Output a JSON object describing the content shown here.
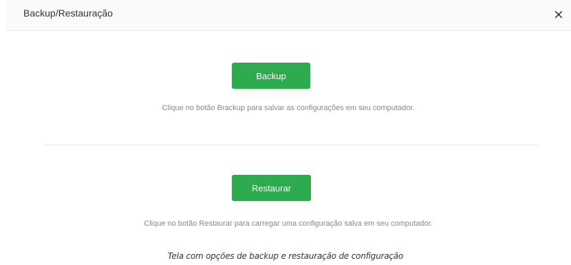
{
  "dialog": {
    "title": "Backup/Restauração",
    "close_symbol": "×"
  },
  "backup": {
    "button_label": "Backup",
    "description": "Clique no botão Brackup para salvar as configurações em seu computador."
  },
  "restore": {
    "button_label": "Restaurar",
    "description": "Clique no botão Restaurar para carregar uma configuração salva em seu computador."
  },
  "caption": "Tela com opções de backup e restauração de configuração",
  "colors": {
    "button_green": "#2eaa4f",
    "header_bg": "#fafafa",
    "description_text": "#888888"
  }
}
